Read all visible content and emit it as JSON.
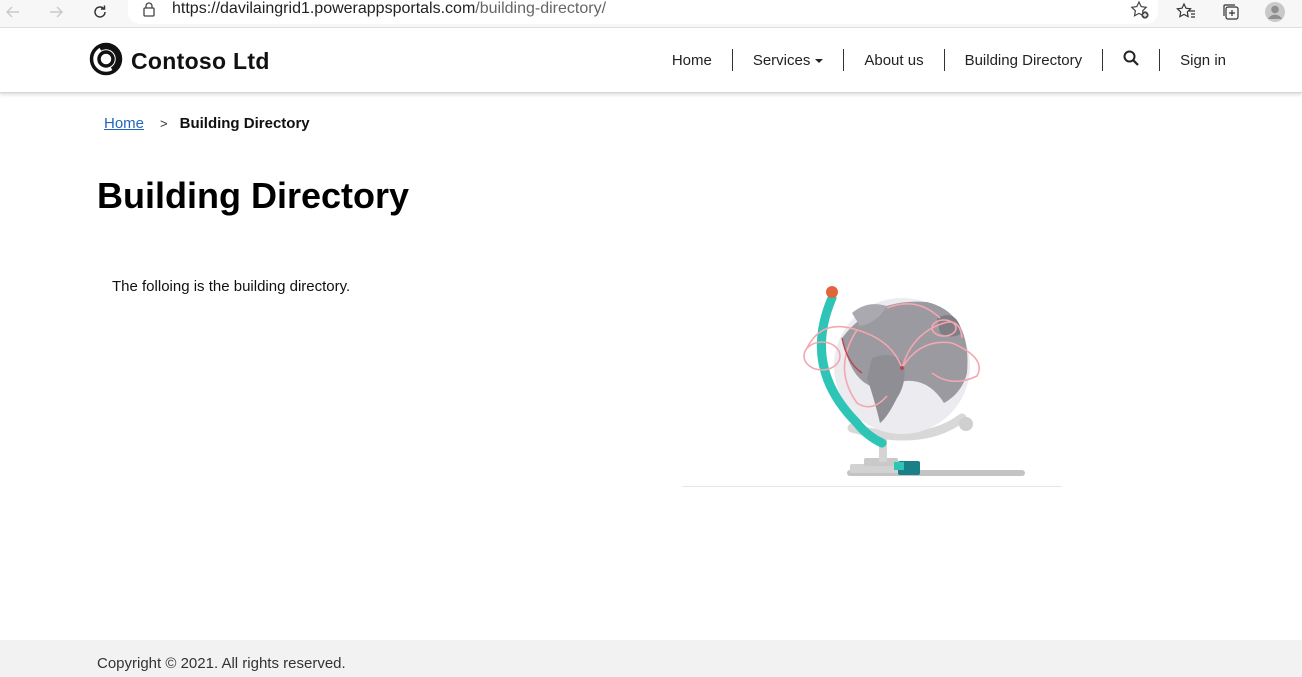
{
  "browser": {
    "url_host": "https://davilaingrid1.powerappsportals.com",
    "url_path": "/building-directory/"
  },
  "header": {
    "brand": "Contoso Ltd",
    "nav": {
      "home": "Home",
      "services": "Services",
      "about": "About us",
      "directory": "Building Directory",
      "signin": "Sign in"
    }
  },
  "breadcrumb": {
    "home": "Home",
    "separator": ">",
    "current": "Building Directory"
  },
  "main": {
    "title": "Building Directory",
    "intro": "The folloing is the building directory."
  },
  "footer": {
    "copyright": "Copyright © 2021. All rights reserved."
  },
  "colors": {
    "link": "#2266bb",
    "globe_ring": "#2ec4b6",
    "globe_land": "#9a9aa0",
    "route": "#f4a7b0",
    "accent_dot": "#e0663a",
    "base_teal": "#1a7f86"
  }
}
